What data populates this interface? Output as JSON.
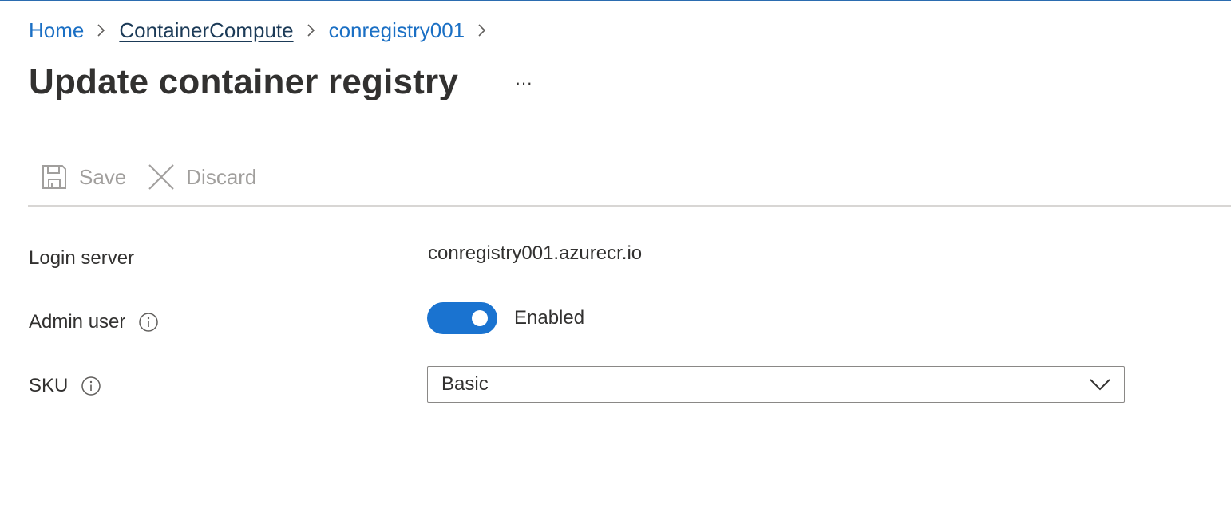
{
  "breadcrumb": {
    "items": [
      {
        "label": "Home"
      },
      {
        "label": "ContainerCompute"
      },
      {
        "label": "conregistry001"
      }
    ]
  },
  "page": {
    "title": "Update container registry",
    "more_label": "···"
  },
  "toolbar": {
    "save_label": "Save",
    "save_icon": "save-icon",
    "discard_label": "Discard",
    "discard_icon": "close-icon",
    "save_enabled": false,
    "discard_enabled": false
  },
  "form": {
    "login_server": {
      "label": "Login server",
      "value": "conregistry001.azurecr.io"
    },
    "admin_user": {
      "label": "Admin user",
      "info_icon": "info-icon",
      "toggle_on": true,
      "toggle_label": "Enabled"
    },
    "sku": {
      "label": "SKU",
      "info_icon": "info-icon",
      "selected": "Basic"
    }
  },
  "colors": {
    "link": "#1a6fc4",
    "current_crumb": "#1b3a57",
    "toggle_on": "#1a73d0",
    "disabled_text": "#a19f9d",
    "text": "#323130"
  }
}
